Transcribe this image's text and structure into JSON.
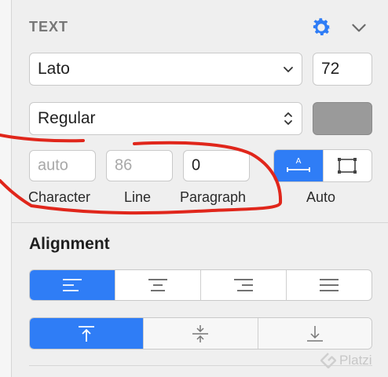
{
  "section": {
    "title": "TEXT"
  },
  "font": {
    "family": "Lato",
    "size": "72",
    "weight": "Regular",
    "color": "#9a9a9a"
  },
  "spacing": {
    "character": {
      "value": "auto",
      "label": "Character"
    },
    "line": {
      "value": "86",
      "label": "Line"
    },
    "paragraph": {
      "value": "0",
      "label": "Paragraph"
    },
    "resize_label": "Auto"
  },
  "alignment": {
    "title": "Alignment",
    "selected_horizontal": "left",
    "selected_vertical": "top"
  },
  "watermark": {
    "text": "Platzi"
  },
  "colors": {
    "accent": "#2f7df6",
    "annotation": "#e0261b"
  }
}
